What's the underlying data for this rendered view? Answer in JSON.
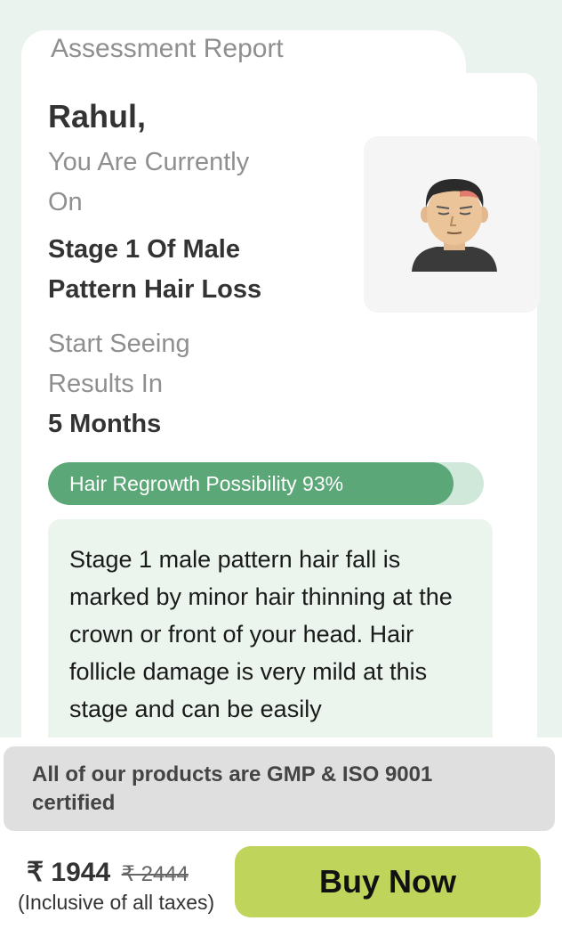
{
  "report": {
    "tab_title": "Assessment Report",
    "user_name": "Rahul,",
    "current_label_line1": "You Are Currently",
    "current_label_line2": "On",
    "stage_line1": "Stage 1 Of Male",
    "stage_line2": "Pattern Hair Loss",
    "results_label_line1": "Start Seeing",
    "results_label_line2": "Results In",
    "results_duration": "5 Months",
    "avatar_icon": "male-face-avatar-icon",
    "regrowth": {
      "label": "Hair Regrowth Possibility 93%",
      "value_percent": 93
    },
    "description": "Stage 1 male pattern hair fall is marked by minor hair thinning at the crown or front of your head. Hair follicle damage is very mild at this stage and can be easily"
  },
  "footer": {
    "certification": "All of our products are GMP & ISO 9001 certified",
    "price": "₹ 1944",
    "mrp": "₹ 2444",
    "tax_note": "(Inclusive of all taxes)",
    "buy_label": "Buy Now"
  },
  "colors": {
    "accent_green": "#5ca777",
    "progress_track": "#cfe8d9",
    "buy_button": "#bfd45a",
    "page_bg": "#ebf3ee"
  }
}
